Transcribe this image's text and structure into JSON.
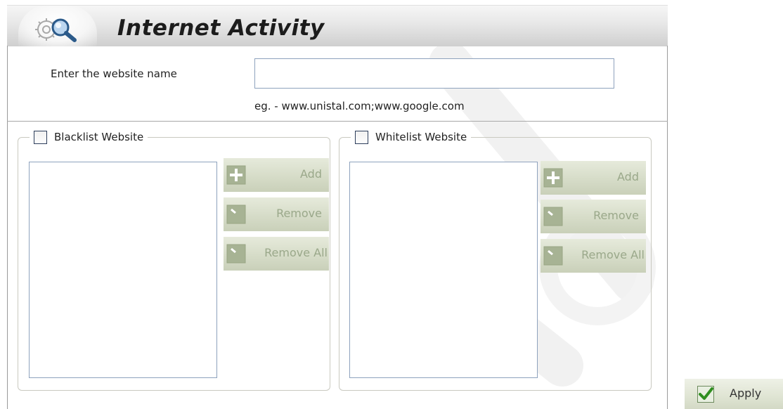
{
  "header": {
    "title": "Internet Activity",
    "icon": "gear-search-icon"
  },
  "website": {
    "label": "Enter the website name",
    "value": "",
    "hint": "eg. - www.unistal.com;www.google.com"
  },
  "blacklist": {
    "legend": "Blacklist Website",
    "checked": false,
    "items": [],
    "add_label": "Add",
    "remove_label": "Remove",
    "remove_all_label": "Remove All"
  },
  "whitelist": {
    "legend": "Whitelist Website",
    "checked": false,
    "items": [],
    "add_label": "Add",
    "remove_label": "Remove",
    "remove_all_label": "Remove All"
  },
  "footer": {
    "apply_label": "Apply"
  },
  "colors": {
    "button_disabled_bg": "#d6dcc8",
    "button_disabled_text": "#9aa88a",
    "border_blue": "#8ea2bd",
    "apply_check_green": "#2f8f1f"
  }
}
